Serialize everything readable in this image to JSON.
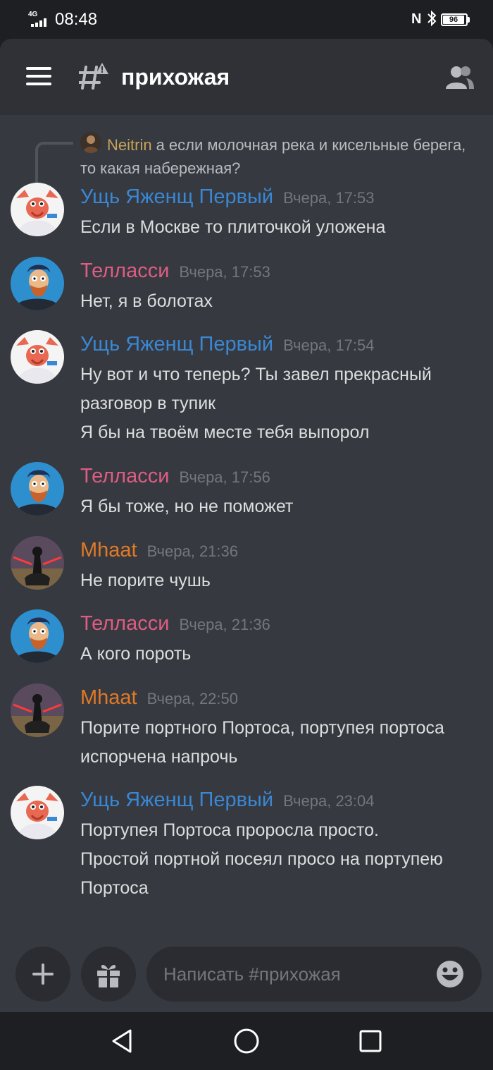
{
  "status": {
    "network": "4G",
    "time": "08:48",
    "battery": "96"
  },
  "header": {
    "channel_name": "прихожая"
  },
  "reply": {
    "author": "Neitrin",
    "text": "а если молочная река и кисельные берега, то какая набережная?"
  },
  "messages": [
    {
      "author": "Ущь Яженщ Первый",
      "timestamp": "Вчера, 17:53",
      "lines": [
        "Если в Москве то плиточкой уложена"
      ],
      "color": "#3a87d4",
      "avatar": "zoidberg-avatar"
    },
    {
      "author": "Телласси",
      "timestamp": "Вчера, 17:53",
      "lines": [
        "Нет, я в болотах"
      ],
      "color": "#df5c83",
      "avatar": "bearded-man-avatar"
    },
    {
      "author": "Ущь Яженщ Первый",
      "timestamp": "Вчера, 17:54",
      "lines": [
        "Ну вот и что теперь? Ты завел прекрасный разговор в тупик",
        "Я бы на твоём месте тебя выпорол"
      ],
      "color": "#3a87d4",
      "avatar": "zoidberg-avatar"
    },
    {
      "author": "Телласси",
      "timestamp": "Вчера, 17:56",
      "lines": [
        "Я бы тоже, но не поможет"
      ],
      "color": "#df5c83",
      "avatar": "bearded-man-avatar"
    },
    {
      "author": "Mhaat",
      "timestamp": "Вчера, 21:36",
      "lines": [
        "Не порите чушь"
      ],
      "color": "#e07a26",
      "avatar": "dark-warrior-avatar"
    },
    {
      "author": "Телласси",
      "timestamp": "Вчера, 21:36",
      "lines": [
        "А кого пороть"
      ],
      "color": "#df5c83",
      "avatar": "bearded-man-avatar"
    },
    {
      "author": "Mhaat",
      "timestamp": "Вчера, 22:50",
      "lines": [
        "Порите портного Портоса, портупея портоса испорчена напрочь"
      ],
      "color": "#e07a26",
      "avatar": "dark-warrior-avatar"
    },
    {
      "author": "Ущь Яженщ Первый",
      "timestamp": "Вчера, 23:04",
      "lines": [
        "Портупея Портоса проросла просто.",
        "Простой портной посеял просо на портупею Портоса"
      ],
      "color": "#3a87d4",
      "avatar": "zoidberg-avatar"
    }
  ],
  "composer": {
    "placeholder": "Написать #прихожая"
  },
  "icons": {
    "menu": "hamburger-icon",
    "channel": "text-channel-warning-icon",
    "members": "members-icon",
    "add": "plus-icon",
    "gift": "gift-icon",
    "emoji": "emoji-icon",
    "back": "back-triangle-icon",
    "home": "home-circle-icon",
    "recents": "recents-square-icon"
  }
}
